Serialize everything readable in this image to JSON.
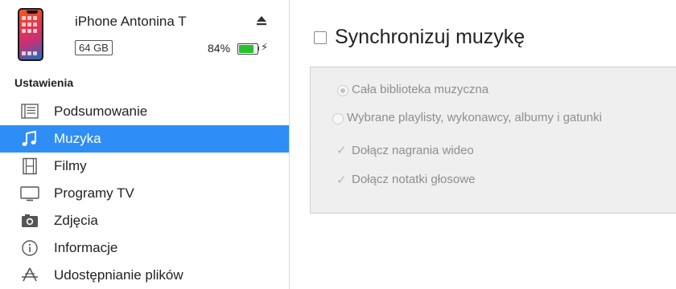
{
  "device": {
    "name": "iPhone Antonina T",
    "capacity": "64 GB",
    "battery_percent_label": "84%",
    "battery_level": 0.84,
    "charging_icon": "lightning-icon",
    "eject_icon": "eject-icon"
  },
  "sidebar": {
    "section_title": "Ustawienia",
    "items": [
      {
        "label": "Podsumowanie",
        "icon": "summary-list-icon",
        "selected": false
      },
      {
        "label": "Muzyka",
        "icon": "music-note-icon",
        "selected": true
      },
      {
        "label": "Filmy",
        "icon": "film-icon",
        "selected": false
      },
      {
        "label": "Programy TV",
        "icon": "tv-icon",
        "selected": false
      },
      {
        "label": "Zdjęcia",
        "icon": "camera-icon",
        "selected": false
      },
      {
        "label": "Informacje",
        "icon": "info-icon",
        "selected": false
      },
      {
        "label": "Udostępnianie plików",
        "icon": "file-sharing-icon",
        "selected": false
      }
    ]
  },
  "main": {
    "sync_title": "Synchronizuj muzykę",
    "sync_checked": false,
    "options": {
      "entire_library": "Cała biblioteka muzyczna",
      "selected_items": "Wybrane playlisty, wykonawcy, albumy i gatunki",
      "include_videos": "Dołącz nagrania wideo",
      "include_voice_memos": "Dołącz notatki głosowe"
    }
  },
  "colors": {
    "selection": "#2f8ef5",
    "battery": "#26c22e",
    "panel": "#efefef"
  }
}
